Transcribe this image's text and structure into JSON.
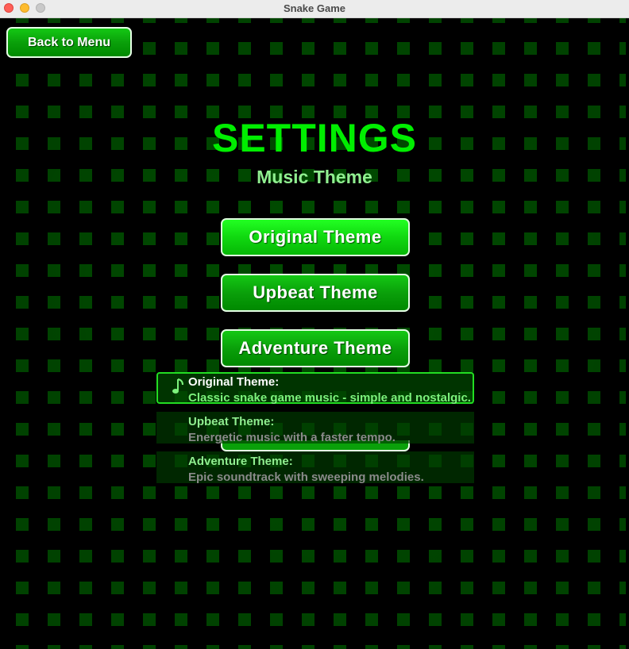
{
  "window": {
    "title": "Snake Game"
  },
  "nav": {
    "back_label": "Back to Menu"
  },
  "page": {
    "title": "SETTINGS",
    "subtitle": "Music Theme"
  },
  "themes": [
    {
      "label": "Original Theme",
      "name": "Original Theme:",
      "description": "Classic snake game music - simple and nostalgic.",
      "selected": true
    },
    {
      "label": "Upbeat Theme",
      "name": "Upbeat Theme:",
      "description": "Energetic music with a faster tempo.",
      "selected": false
    },
    {
      "label": "Adventure Theme",
      "name": "Adventure Theme:",
      "description": "Epic soundtrack with sweeping melodies.",
      "selected": false
    }
  ],
  "selected_indicator_icon": "music-note-icon",
  "colors": {
    "accent": "#00ee00",
    "subtitle": "#90ee90",
    "button": "#0aa00a",
    "background": "#000000"
  }
}
